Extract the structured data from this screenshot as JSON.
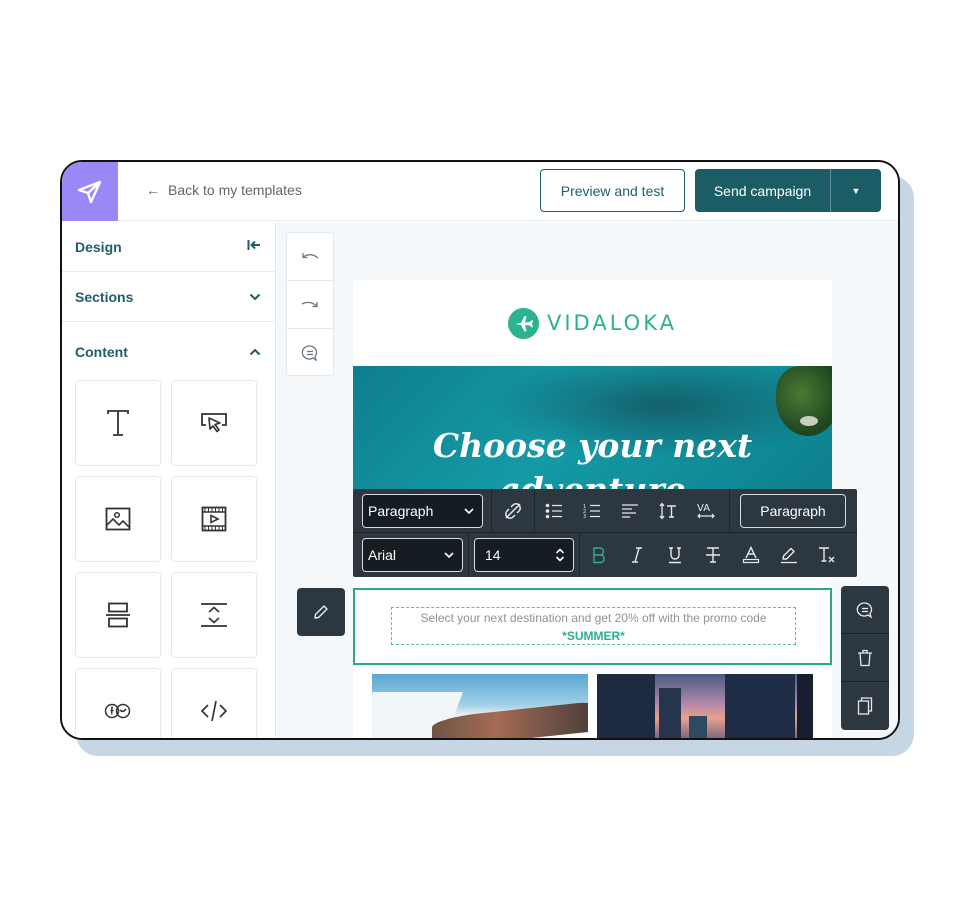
{
  "header": {
    "back_label": "Back to my templates",
    "preview_label": "Preview and test",
    "send_label": "Send campaign"
  },
  "sidebar": {
    "design_label": "Design",
    "sections_label": "Sections",
    "content_label": "Content",
    "blocks": [
      {
        "name": "text-block-tile",
        "icon": "text-icon"
      },
      {
        "name": "button-block-tile",
        "icon": "button-cursor-icon"
      },
      {
        "name": "image-block-tile",
        "icon": "image-icon"
      },
      {
        "name": "video-block-tile",
        "icon": "video-icon"
      },
      {
        "name": "divider-block-tile",
        "icon": "divider-icon"
      },
      {
        "name": "spacer-block-tile",
        "icon": "spacer-icon"
      },
      {
        "name": "social-block-tile",
        "icon": "social-icon"
      },
      {
        "name": "html-block-tile",
        "icon": "code-icon"
      }
    ]
  },
  "email": {
    "brand_name": "VIDALOKA",
    "hero_title": "Choose your next adventure",
    "body_text": "Select your next destination and get 20% off with the promo code",
    "promo_code": "*SUMMER*"
  },
  "toolbar": {
    "block_style": "Paragraph",
    "font_family": "Arial",
    "font_size": "14",
    "paragraph_button": "Paragraph"
  },
  "colors": {
    "brand_purple": "#9b87f5",
    "primary_teal": "#1c5c64",
    "accent_green": "#2bb290",
    "toolbar_dark": "#2c3740"
  }
}
